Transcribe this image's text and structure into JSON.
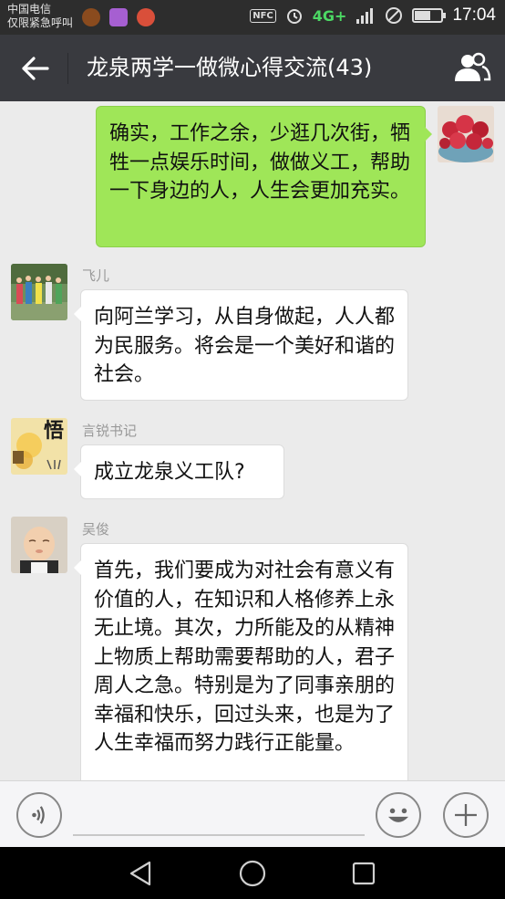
{
  "status_bar": {
    "carrier_line1": "中国电信",
    "carrier_line2": "仅限紧急呼叫",
    "nfc_label": "NFC",
    "network": "4G+",
    "time": "17:04"
  },
  "header": {
    "title": "龙泉两学一做微心得交流(43)"
  },
  "messages": [
    {
      "direction": "out",
      "sender": "",
      "text": "确实，工作之余，少逛几次街，牺牲一点娱乐时间，做做义工，帮助一下身边的人，人生会更加充实。"
    },
    {
      "direction": "in",
      "sender": "飞儿",
      "text": "向阿兰学习，从自身做起，人人都为民服务。将会是一个美好和谐的社会。"
    },
    {
      "direction": "in",
      "sender": "言锐书记",
      "text": "成立龙泉义工队?"
    },
    {
      "direction": "in",
      "sender": "吴俊",
      "text": "首先，我们要成为对社会有意义有价值的人，在知识和人格修养上永无止境。其次，力所能及的从精神上物质上帮助需要帮助的人，君子周人之急。特别是为了同事亲朋的幸福和快乐，回过头来，也是为了人生幸福而努力践行正能量。"
    }
  ],
  "avatar_badges": {
    "yanrui": "悟"
  },
  "input": {
    "value": "",
    "placeholder": ""
  },
  "colors": {
    "status_bar_bg": "#2d2d2d",
    "title_bar_bg": "#393a3f",
    "chat_bg": "#ebebeb",
    "outgoing_bubble": "#9fe658",
    "incoming_bubble": "#ffffff",
    "network_green": "#4cd964"
  },
  "icons": {
    "back": "back-arrow-icon",
    "group": "group-members-icon",
    "voice": "voice-icon",
    "emoji": "emoji-icon",
    "plus": "plus-icon",
    "nav_back": "nav-back-icon",
    "nav_home": "nav-home-icon",
    "nav_recents": "nav-recents-icon"
  }
}
